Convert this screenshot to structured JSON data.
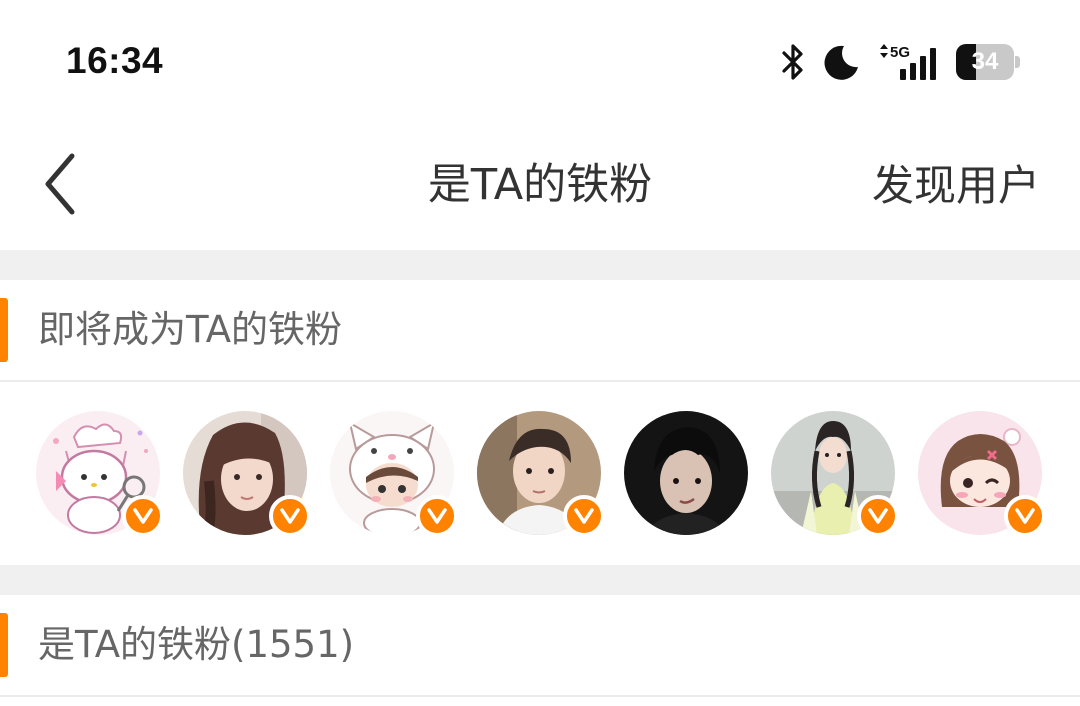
{
  "status_bar": {
    "time": "16:34",
    "battery_level": "34",
    "battery_fraction": 0.34,
    "network": "5G",
    "icons": [
      "bluetooth-icon",
      "do-not-disturb-moon-icon",
      "5g-signal-icon",
      "battery-icon"
    ]
  },
  "nav": {
    "back_icon": "chevron-left-icon",
    "title": "是TA的铁粉",
    "discover_label": "发现用户"
  },
  "sections": {
    "upcoming": {
      "title": "即将成为TA的铁粉",
      "avatars": [
        {
          "name": "avatar-1",
          "style": "pink-cartoon-cat",
          "verified": true
        },
        {
          "name": "avatar-2",
          "style": "photo-girl-long-hair",
          "verified": true
        },
        {
          "name": "avatar-3",
          "style": "chibi-hood-cartoon",
          "verified": true
        },
        {
          "name": "avatar-4",
          "style": "photo-boy-white-shirt",
          "verified": true
        },
        {
          "name": "avatar-5",
          "style": "photo-boy-dark",
          "verified": true
        },
        {
          "name": "avatar-6",
          "style": "photo-girl-hanfu",
          "verified": true
        },
        {
          "name": "avatar-7",
          "style": "pink-chibi-girl",
          "verified": true
        }
      ]
    },
    "fans": {
      "title": "是TA的铁粉(1551)"
    }
  },
  "colors": {
    "accent": "#ff8200",
    "band": "#f0f0f0",
    "title_text": "#333333",
    "section_text": "#666666"
  }
}
